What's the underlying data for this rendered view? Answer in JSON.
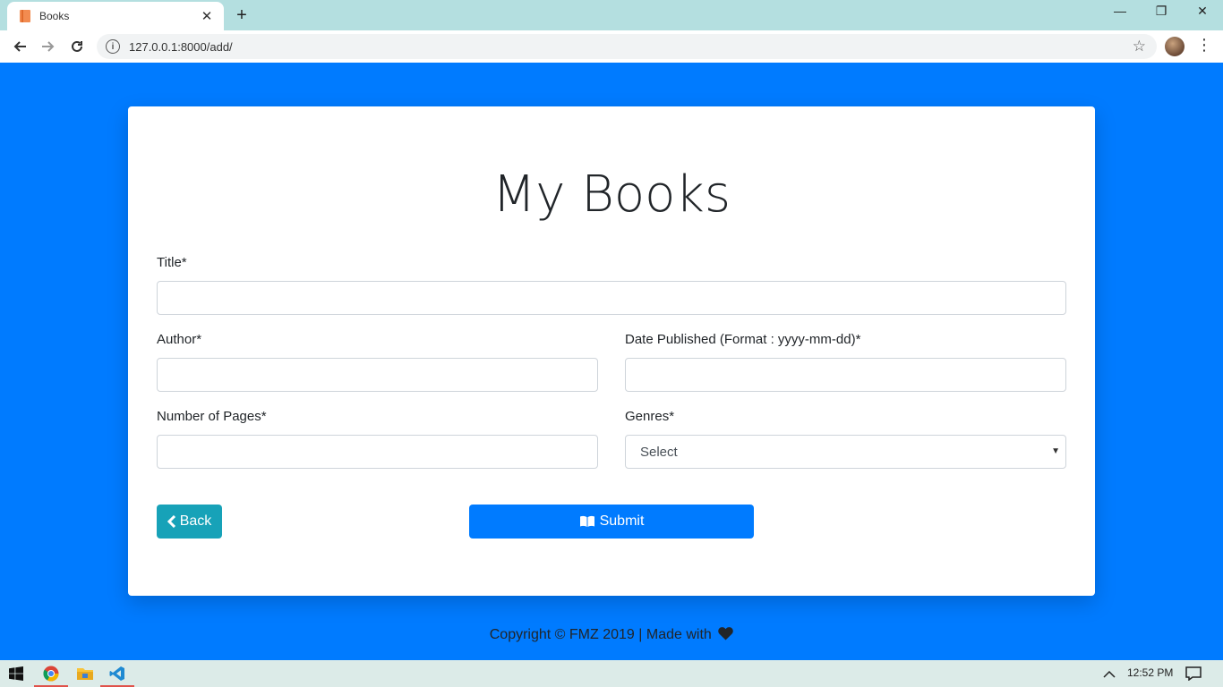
{
  "browser": {
    "tab_title": "Books",
    "tab_close": "✕",
    "new_tab": "+",
    "url": "127.0.0.1:8000/add/",
    "window_minimize": "—",
    "window_restore": "❐",
    "window_close": "✕"
  },
  "page": {
    "title": "My Books",
    "form": {
      "title_label": "Title*",
      "title_value": "",
      "author_label": "Author*",
      "author_value": "",
      "date_label": "Date Published (Format : yyyy-mm-dd)*",
      "date_value": "",
      "pages_label": "Number of Pages*",
      "pages_value": "",
      "genres_label": "Genres*",
      "genres_selected": "Select"
    },
    "back_label": "Back",
    "submit_label": "Submit",
    "footer_text": "Copyright © FMZ 2019 | Made with"
  },
  "colors": {
    "background": "#007bff",
    "back_button": "#17a2b8",
    "submit_button": "#007bff"
  },
  "taskbar": {
    "clock": "12:52 PM",
    "apps": [
      "chrome-icon",
      "file-explorer-icon",
      "vscode-icon"
    ]
  }
}
